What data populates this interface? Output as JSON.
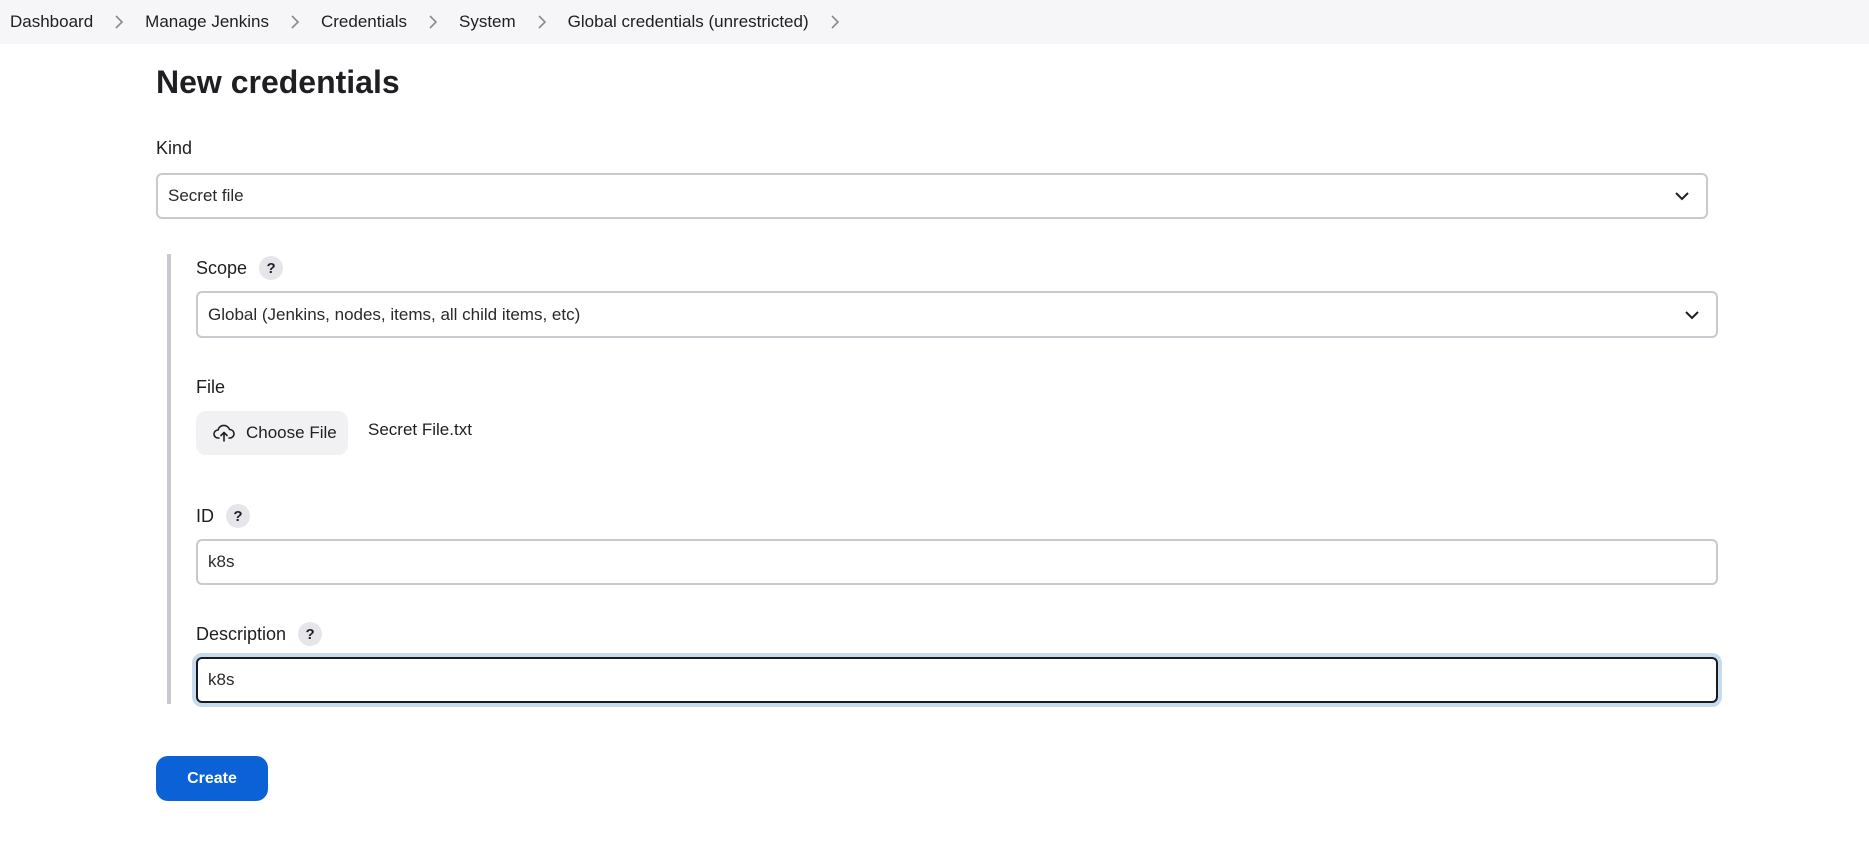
{
  "breadcrumb": [
    {
      "label": "Dashboard"
    },
    {
      "label": "Manage Jenkins"
    },
    {
      "label": "Credentials"
    },
    {
      "label": "System"
    },
    {
      "label": "Global credentials (unrestricted)"
    }
  ],
  "page_title": "New credentials",
  "kind": {
    "label": "Kind",
    "value": "Secret file"
  },
  "scope": {
    "label": "Scope",
    "help": "?",
    "value": "Global (Jenkins, nodes, items, all child items, etc)"
  },
  "file": {
    "label": "File",
    "button_label": "Choose File",
    "file_name": "Secret File.txt"
  },
  "id_field": {
    "label": "ID",
    "help": "?",
    "value": "k8s"
  },
  "description": {
    "label": "Description",
    "help": "?",
    "value": "k8s"
  },
  "create_button": {
    "label": "Create"
  },
  "colors": {
    "accent": "#0b62d6",
    "breadcrumb_bg": "#f6f6f8",
    "focus_ring": "#c7dbef"
  },
  "icons": {
    "breadcrumb_separator": "chevron-right-icon",
    "dropdown": "chevron-down-icon",
    "upload": "cloud-upload-icon",
    "help": "help-icon"
  }
}
